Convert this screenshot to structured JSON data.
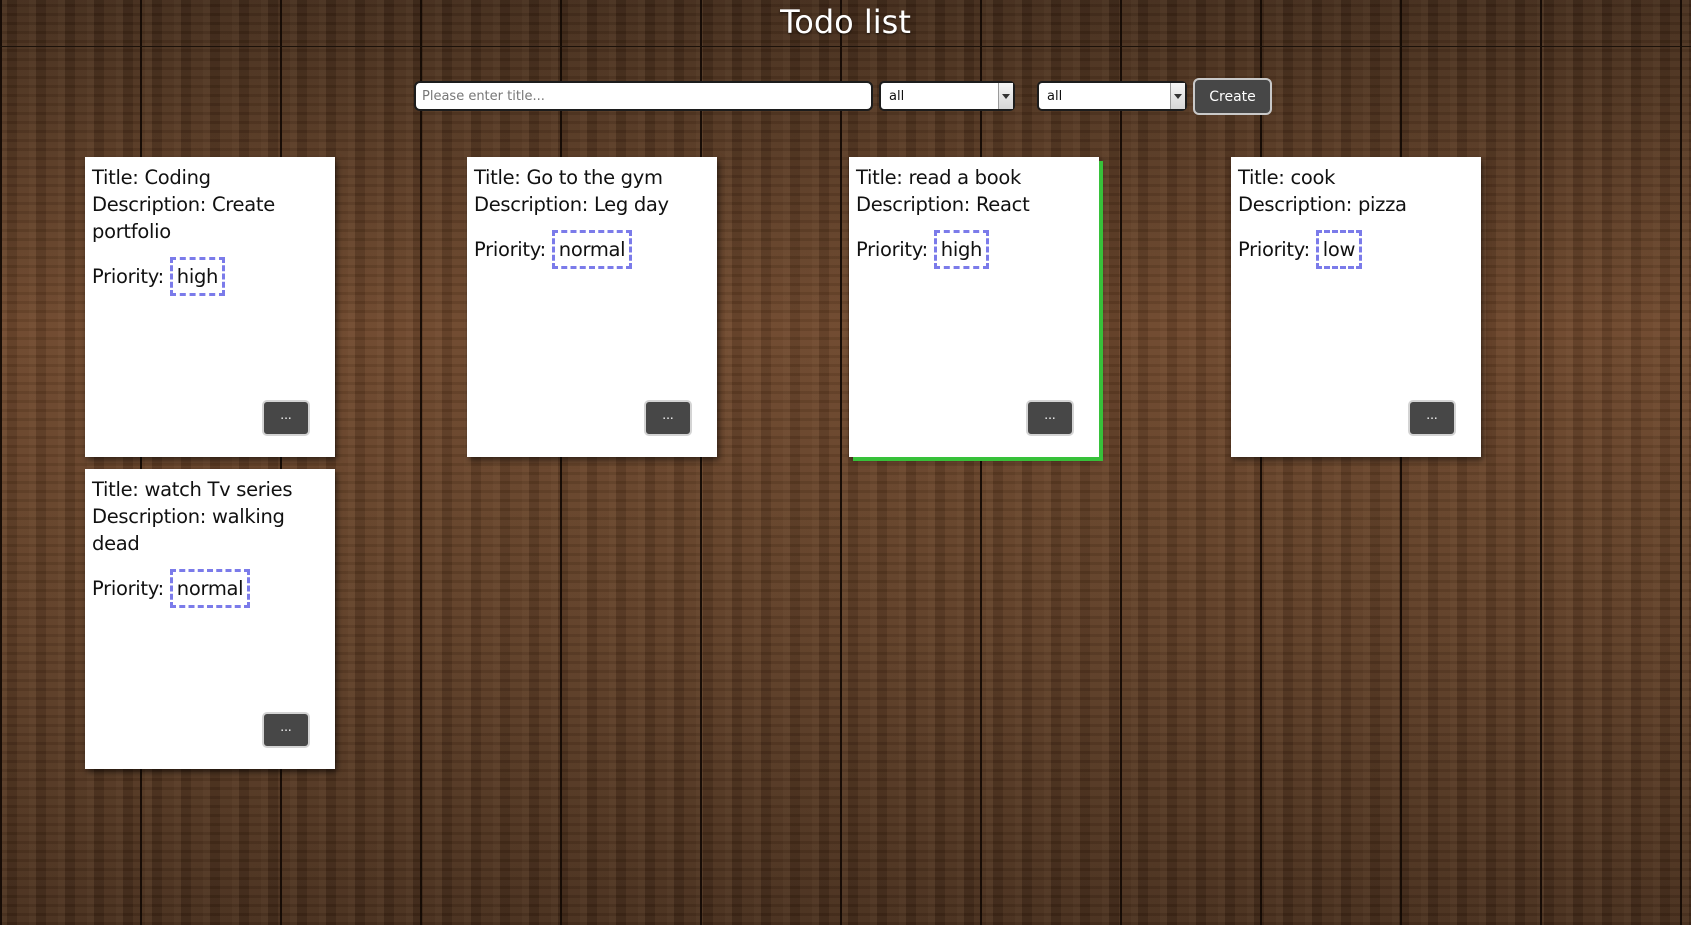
{
  "app": {
    "title": "Todo list"
  },
  "toolbar": {
    "title_placeholder": "Please enter title...",
    "filter_1_value": "all",
    "filter_2_value": "all",
    "create_label": "Create"
  },
  "labels": {
    "title_prefix": "Title: ",
    "description_prefix": "Description: ",
    "priority_prefix": "Priority: ",
    "more_label": "..."
  },
  "todos": [
    {
      "title": "Coding",
      "description": "Create portfolio",
      "priority": "high",
      "selected": false
    },
    {
      "title": "Go to the gym",
      "description": "Leg day",
      "priority": "normal",
      "selected": false
    },
    {
      "title": "read a book",
      "description": "React",
      "priority": "high",
      "selected": true
    },
    {
      "title": "cook",
      "description": "pizza",
      "priority": "low",
      "selected": false
    },
    {
      "title": "watch Tv series",
      "description": "walking dead",
      "priority": "normal",
      "selected": false
    }
  ],
  "colors": {
    "selected_accent": "#37c13a",
    "priority_border": "#7b7bea",
    "button_bg": "#474747"
  }
}
